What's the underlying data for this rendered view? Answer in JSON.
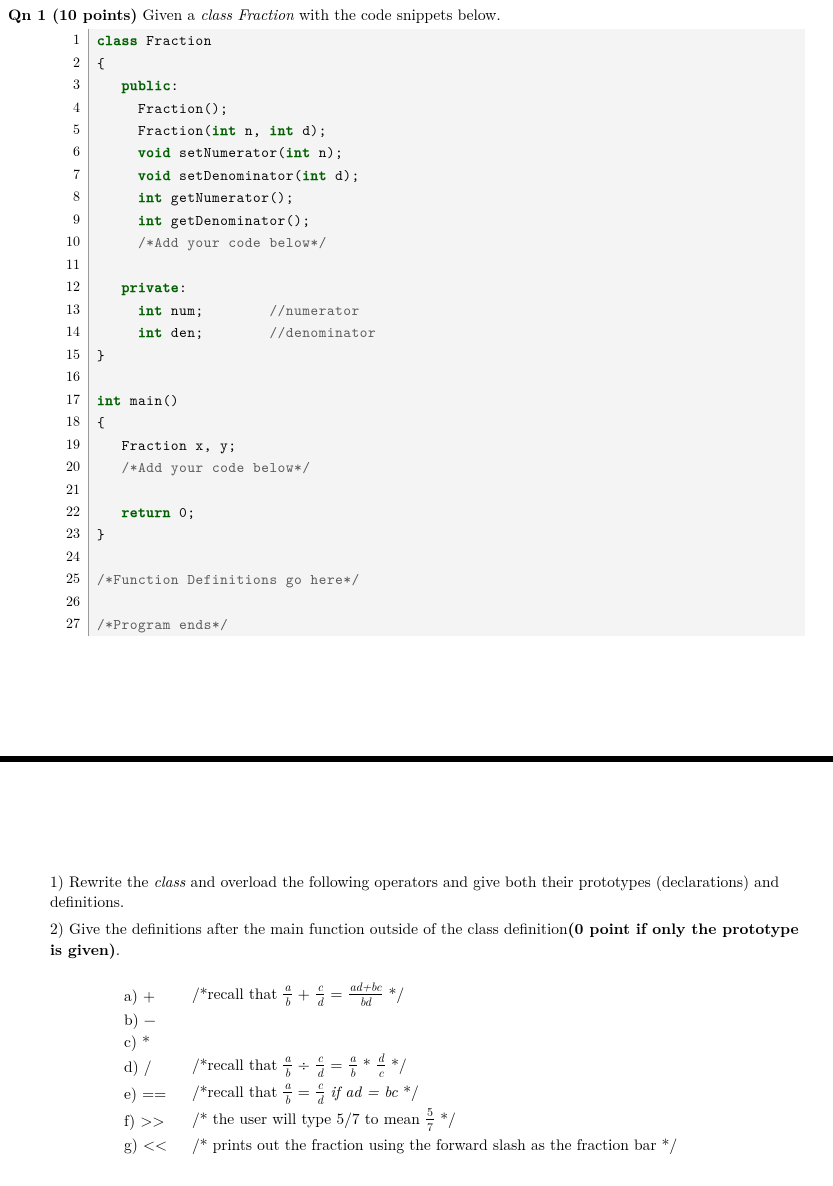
{
  "question": {
    "label_bold": "Qn 1 (10 points)",
    "intro_prefix": " Given a ",
    "intro_italic": "class Fraction",
    "intro_suffix": " with the code snippets below."
  },
  "code": {
    "lines": [
      {
        "n": "1",
        "tokens": [
          {
            "t": "class ",
            "c": "kw"
          },
          {
            "t": "Fraction",
            "c": ""
          }
        ]
      },
      {
        "n": "2",
        "tokens": [
          {
            "t": "{",
            "c": ""
          }
        ]
      },
      {
        "n": "3",
        "tokens": [
          {
            "t": "   ",
            "c": ""
          },
          {
            "t": "public",
            "c": "kw"
          },
          {
            "t": ":",
            "c": ""
          }
        ]
      },
      {
        "n": "4",
        "tokens": [
          {
            "t": "     Fraction();",
            "c": ""
          }
        ]
      },
      {
        "n": "5",
        "tokens": [
          {
            "t": "     Fraction(",
            "c": ""
          },
          {
            "t": "int",
            "c": "kw"
          },
          {
            "t": " n, ",
            "c": ""
          },
          {
            "t": "int",
            "c": "kw"
          },
          {
            "t": " d);",
            "c": ""
          }
        ]
      },
      {
        "n": "6",
        "tokens": [
          {
            "t": "     ",
            "c": ""
          },
          {
            "t": "void",
            "c": "kw"
          },
          {
            "t": " setNumerator(",
            "c": ""
          },
          {
            "t": "int",
            "c": "kw"
          },
          {
            "t": " n);",
            "c": ""
          }
        ]
      },
      {
        "n": "7",
        "tokens": [
          {
            "t": "     ",
            "c": ""
          },
          {
            "t": "void",
            "c": "kw"
          },
          {
            "t": " setDenominator(",
            "c": ""
          },
          {
            "t": "int",
            "c": "kw"
          },
          {
            "t": " d);",
            "c": ""
          }
        ]
      },
      {
        "n": "8",
        "tokens": [
          {
            "t": "     ",
            "c": ""
          },
          {
            "t": "int",
            "c": "kw"
          },
          {
            "t": " getNumerator();",
            "c": ""
          }
        ]
      },
      {
        "n": "9",
        "tokens": [
          {
            "t": "     ",
            "c": ""
          },
          {
            "t": "int",
            "c": "kw"
          },
          {
            "t": " getDenominator();",
            "c": ""
          }
        ]
      },
      {
        "n": "10",
        "tokens": [
          {
            "t": "     ",
            "c": ""
          },
          {
            "t": "/*Add your code below*/",
            "c": "cmt"
          }
        ]
      },
      {
        "n": "11",
        "tokens": [
          {
            "t": "",
            "c": ""
          }
        ]
      },
      {
        "n": "12",
        "tokens": [
          {
            "t": "   ",
            "c": ""
          },
          {
            "t": "private",
            "c": "kw"
          },
          {
            "t": ":",
            "c": ""
          }
        ]
      },
      {
        "n": "13",
        "tokens": [
          {
            "t": "     ",
            "c": ""
          },
          {
            "t": "int",
            "c": "kw"
          },
          {
            "t": " num;        ",
            "c": ""
          },
          {
            "t": "//numerator",
            "c": "cmt"
          }
        ]
      },
      {
        "n": "14",
        "tokens": [
          {
            "t": "     ",
            "c": ""
          },
          {
            "t": "int",
            "c": "kw"
          },
          {
            "t": " den;        ",
            "c": ""
          },
          {
            "t": "//denominator",
            "c": "cmt"
          }
        ]
      },
      {
        "n": "15",
        "tokens": [
          {
            "t": "}",
            "c": ""
          }
        ]
      },
      {
        "n": "16",
        "tokens": [
          {
            "t": "",
            "c": ""
          }
        ]
      },
      {
        "n": "17",
        "tokens": [
          {
            "t": "int",
            "c": "kw"
          },
          {
            "t": " main()",
            "c": ""
          }
        ]
      },
      {
        "n": "18",
        "tokens": [
          {
            "t": "{",
            "c": ""
          }
        ]
      },
      {
        "n": "19",
        "tokens": [
          {
            "t": "   Fraction x, y;",
            "c": ""
          }
        ]
      },
      {
        "n": "20",
        "tokens": [
          {
            "t": "   ",
            "c": ""
          },
          {
            "t": "/*Add your code below*/",
            "c": "cmt"
          }
        ]
      },
      {
        "n": "21",
        "tokens": [
          {
            "t": "",
            "c": ""
          }
        ]
      },
      {
        "n": "22",
        "tokens": [
          {
            "t": "   ",
            "c": ""
          },
          {
            "t": "return",
            "c": "kw"
          },
          {
            "t": " 0;",
            "c": ""
          }
        ]
      },
      {
        "n": "23",
        "tokens": [
          {
            "t": "}",
            "c": ""
          }
        ]
      },
      {
        "n": "24",
        "tokens": [
          {
            "t": "",
            "c": ""
          }
        ]
      },
      {
        "n": "25",
        "tokens": [
          {
            "t": "/*Function Definitions go here*/",
            "c": "cmt"
          }
        ]
      },
      {
        "n": "26",
        "tokens": [
          {
            "t": "",
            "c": ""
          }
        ]
      },
      {
        "n": "27",
        "tokens": [
          {
            "t": "/*Program ends*/",
            "c": "cmt"
          }
        ]
      }
    ]
  },
  "instructions": {
    "p1_prefix": "1) Rewrite the ",
    "p1_italic": "class",
    "p1_suffix": " and overload the following operators and give both their prototypes (declarations) and definitions.",
    "p2_prefix": "2) Give the definitions after the main function outside of the class definition",
    "p2_bold": "(0 point if only the prototype is given)",
    "p2_suffix": "."
  },
  "ops": {
    "a": {
      "label": "a) +"
    },
    "b": {
      "label": "b) −"
    },
    "c": {
      "label": "c) *"
    },
    "d": {
      "label": "d) /"
    },
    "e": {
      "label": "e) =="
    },
    "f": {
      "label": "f) >>",
      "hint": "/* the user will type 5/7 to mean "
    },
    "g": {
      "label": "g) <<",
      "hint": "/* prints out the fraction using the forward slash as the fraction bar */"
    }
  },
  "math": {
    "recall_prefix": "/*recall that ",
    "star_suffix": " */",
    "plus": {
      "ab_n": "a",
      "ab_d": "b",
      "cd_n": "c",
      "cd_d": "d",
      "res_n": "ad+bc",
      "res_d": "bd"
    },
    "div": {
      "ab_n": "a",
      "ab_d": "b",
      "cd_n": "c",
      "cd_d": "d",
      "dc_n": "d",
      "dc_d": "c"
    },
    "eq": {
      "ab_n": "a",
      "ab_d": "b",
      "cd_n": "c",
      "cd_d": "d",
      "cond": " if ad = bc "
    },
    "five_seven": {
      "n": "5",
      "d": "7"
    }
  }
}
